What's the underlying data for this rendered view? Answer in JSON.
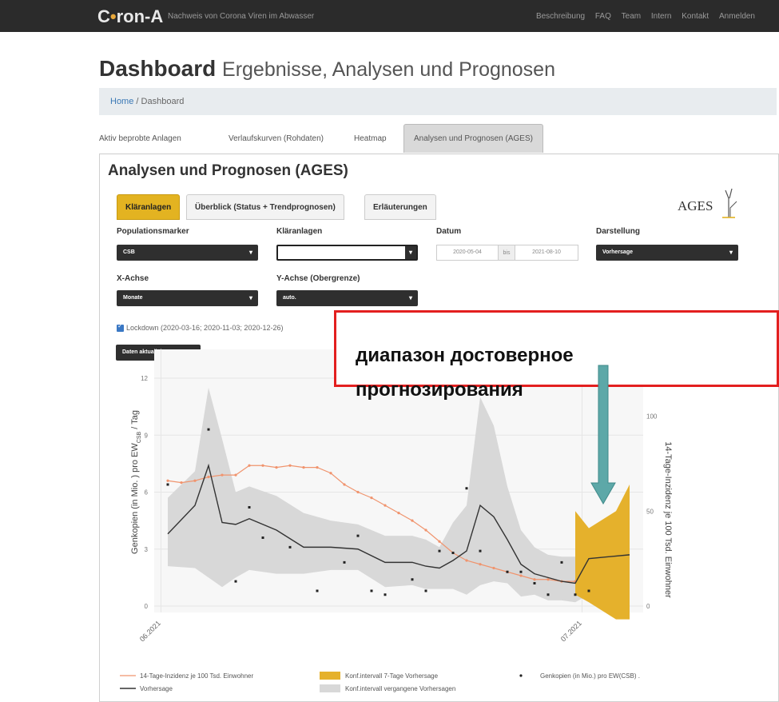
{
  "navbar": {
    "brand_pre": "C",
    "brand_dot": "•",
    "brand_post": "ron-A",
    "tagline": "Nachweis von Corona Viren im Abwasser",
    "links": [
      "Beschreibung",
      "FAQ",
      "Team",
      "Intern",
      "Kontakt",
      "Anmelden"
    ]
  },
  "page": {
    "title": "Dashboard",
    "subtitle": "Ergebnisse, Analysen und Prognosen",
    "breadcrumb_home": "Home",
    "breadcrumb_sep": "/",
    "breadcrumb_current": "Dashboard"
  },
  "tabs": [
    {
      "label": "Aktiv beprobte Anlagen"
    },
    {
      "label": "Verlaufskurven (Rohdaten)"
    },
    {
      "label": "Heatmap"
    },
    {
      "label": "Analysen und Prognosen (AGES)",
      "active": true
    }
  ],
  "panel": {
    "title": "Analysen und Prognosen (AGES)",
    "subtabs": [
      {
        "label": "Kläranlagen",
        "active": true
      },
      {
        "label": "Überblick (Status + Trendprognosen)"
      },
      {
        "label": "Erläuterungen"
      }
    ],
    "logo_text": "AGES"
  },
  "controls": {
    "populationsmarker_label": "Populationsmarker",
    "populationsmarker_value": "CSB",
    "klaeranlagen_label": "Kläranlagen",
    "klaeranlagen_value": "",
    "datum_label": "Datum",
    "date_from": "2020-05-04",
    "date_sep": "bis",
    "date_to": "2021-08-10",
    "darstellung_label": "Darstellung",
    "darstellung_value": "Vorhersage",
    "xachse_label": "X-Achse",
    "xachse_value": "Monate",
    "yachse_label": "Y-Achse (Obergrenze)",
    "yachse_value": "auto.",
    "lockdown_label": "Lockdown (2020-03-16; 2020-11-03; 2020-12-26)",
    "update_button": "Daten aktualisieren"
  },
  "chart_data": {
    "type": "line",
    "y_left_label": "Genkopien (in Mio. ) pro EW",
    "y_left_label_sub": "CSB",
    "y_left_label_suffix": " / Tag",
    "y_left_ticks": [
      "0",
      "3",
      "6",
      "9",
      "12"
    ],
    "y_right_label": "14-Tage-Inzidenz je 100 Tsd. Einwohner",
    "y_right_ticks": [
      "0",
      "50",
      "100"
    ],
    "x_ticks": [
      "06.2021",
      "07.2021"
    ],
    "ylim": [
      0,
      12
    ],
    "y2lim": [
      0,
      120
    ],
    "incidence_x": [
      1,
      2,
      3,
      4,
      5,
      6,
      7,
      8,
      9,
      10,
      11,
      12,
      13,
      14,
      15,
      16,
      17,
      18,
      19,
      20,
      21,
      22,
      23,
      24,
      25,
      26,
      27,
      28,
      29,
      30,
      31
    ],
    "incidence": [
      66,
      65,
      66,
      68,
      69,
      69,
      74,
      74,
      73,
      74,
      73,
      73,
      70,
      64,
      60,
      57,
      53,
      49,
      45,
      40,
      34,
      28,
      24,
      22,
      20,
      18,
      16,
      14,
      14,
      13,
      13
    ],
    "forecast_x": [
      1,
      3,
      4,
      5,
      6,
      7,
      9,
      11,
      13,
      15,
      17,
      19,
      20,
      21,
      22,
      23,
      24,
      25,
      26,
      27,
      28,
      29,
      30,
      31,
      32,
      35
    ],
    "forecast": [
      3.8,
      5.3,
      7.4,
      4.4,
      4.3,
      4.6,
      4.0,
      3.1,
      3.1,
      3.0,
      2.3,
      2.3,
      2.1,
      2.0,
      2.4,
      2.9,
      5.3,
      4.7,
      3.5,
      2.2,
      1.7,
      1.5,
      1.3,
      1.2,
      2.5,
      2.7
    ],
    "past_ci_upper": [
      5.7,
      7.1,
      11.5,
      8.8,
      6.0,
      6.3,
      5.8,
      4.9,
      4.5,
      4.3,
      3.7,
      3.7,
      3.5,
      3.1,
      4.4,
      5.3,
      11.0,
      9.5,
      6.3,
      4.0,
      3.1,
      2.7,
      2.6,
      2.6,
      3.7
    ],
    "past_ci_lower": [
      2.1,
      2.0,
      1.5,
      1.0,
      1.5,
      1.9,
      1.7,
      1.7,
      1.9,
      1.9,
      1.0,
      1.1,
      0.9,
      0.9,
      0.9,
      0.6,
      1.1,
      1.3,
      1.2,
      0.5,
      0.6,
      0.3,
      0.3,
      0.2,
      0.6
    ],
    "future_ci_upper": [
      5.0,
      4.1,
      5.0,
      6.4
    ],
    "future_ci_lower": [
      0.6,
      0.2,
      -0.7,
      -0.7
    ],
    "points_x": [
      1,
      4,
      6,
      7,
      8,
      10,
      12,
      14,
      15,
      16,
      17,
      19,
      20,
      21,
      22,
      23,
      24,
      26,
      27,
      28,
      29,
      30,
      31,
      32
    ],
    "points": [
      6.4,
      9.3,
      1.3,
      5.2,
      3.6,
      3.1,
      0.8,
      2.3,
      3.7,
      0.8,
      0.6,
      1.4,
      0.8,
      2.9,
      2.8,
      6.2,
      2.9,
      1.8,
      1.8,
      1.2,
      0.6,
      2.3,
      0.6,
      0.8
    ],
    "legend": [
      {
        "label": "14-Tage-Inzidenz je 100 Tsd. Einwohner",
        "color": "#f0946e"
      },
      {
        "label": "Konf.intervall 7-Tage Vorhersage",
        "color": "#e5b12c"
      },
      {
        "label": "Genkopien (in Mio.) pro EW(CSB) .",
        "color": "#222222"
      },
      {
        "label": "Vorhersage",
        "color": "#333333"
      },
      {
        "label": "Konf.intervall vergangene Vorhersagen",
        "color": "#d8d8d8"
      }
    ]
  },
  "annotation": {
    "line1": "диапазон достоверное",
    "line2": "прогнозирования",
    "color": "#e31f1f",
    "arrow_color": "#5da8a8"
  }
}
